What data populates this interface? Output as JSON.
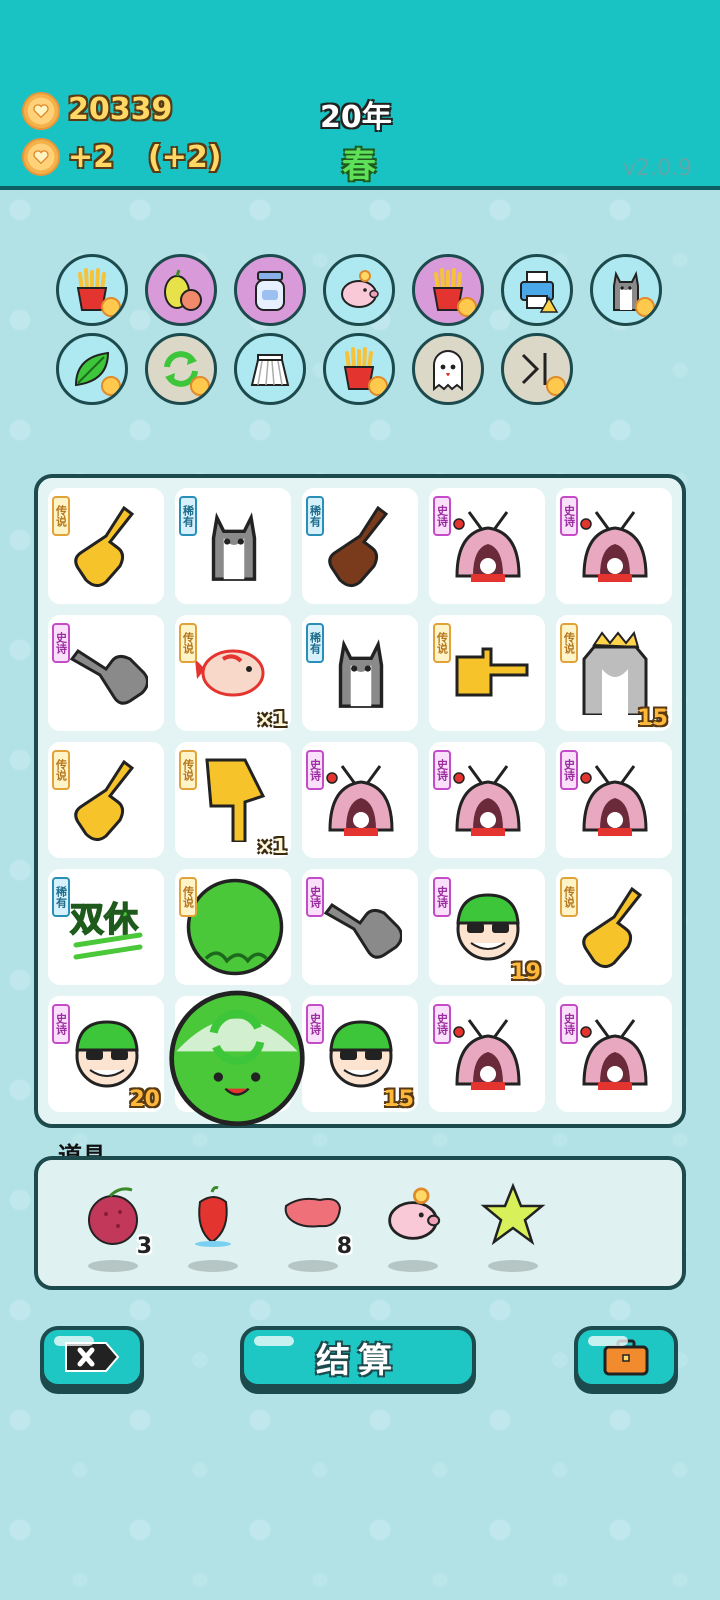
{
  "header": {
    "coins": "20339",
    "income": "+2",
    "income_bonus": "(+2)",
    "year": "20年",
    "season": "春",
    "version": "v2.0.9"
  },
  "relics": [
    {
      "icon": "fries-icon",
      "bg": "#aee8f0",
      "badge": true
    },
    {
      "icon": "pomelo-icon",
      "bg": "#d99ad9",
      "badge": false
    },
    {
      "icon": "jar-icon",
      "bg": "#d99ad9",
      "badge": false
    },
    {
      "icon": "piggy-bank-icon",
      "bg": "#aee8f0",
      "badge": false
    },
    {
      "icon": "fries-icon",
      "bg": "#d99ad9",
      "badge": true
    },
    {
      "icon": "printer-icon",
      "bg": "#aee8f0",
      "badge": false
    },
    {
      "icon": "husky-icon",
      "bg": "#aee8f0",
      "badge": true
    },
    {
      "icon": "leaf-icon",
      "bg": "#aee8f0",
      "badge": true
    },
    {
      "icon": "refresh-icon",
      "bg": "#dcd8c8",
      "badge": true
    },
    {
      "icon": "skirt-icon",
      "bg": "#aee8f0",
      "badge": false
    },
    {
      "icon": "fries-icon",
      "bg": "#aee8f0",
      "badge": true
    },
    {
      "icon": "ghost-icon",
      "bg": "#dcd8c8",
      "badge": false
    },
    {
      "icon": "skip-icon",
      "bg": "#dcd8c8",
      "badge": true
    }
  ],
  "board": {
    "rows": [
      [
        {
          "tag": "传说",
          "kind": "legend",
          "icon": "yellow-finger-icon"
        },
        {
          "tag": "稀有",
          "kind": "rare",
          "icon": "husky-icon"
        },
        {
          "tag": "稀有",
          "kind": "rare",
          "icon": "brown-finger-icon"
        },
        {
          "tag": "史诗",
          "kind": "epic",
          "icon": "rabbit-house-icon"
        },
        {
          "tag": "史诗",
          "kind": "epic",
          "icon": "rabbit-house-icon"
        }
      ],
      [
        {
          "tag": "史诗",
          "kind": "epic",
          "icon": "gray-finger-icon"
        },
        {
          "tag": "传说",
          "kind": "legend",
          "icon": "koi-fish-icon",
          "mult": "×1"
        },
        {
          "tag": "稀有",
          "kind": "rare",
          "icon": "husky-icon"
        },
        {
          "tag": "传说",
          "kind": "legend",
          "icon": "yellow-point-right-icon"
        },
        {
          "tag": "传说",
          "kind": "legend",
          "icon": "crowned-cat-icon",
          "count": "15"
        }
      ],
      [
        {
          "tag": "传说",
          "kind": "legend",
          "icon": "yellow-finger-icon"
        },
        {
          "tag": "传说",
          "kind": "legend",
          "icon": "big-yellow-finger-icon",
          "mult": "×1"
        },
        {
          "tag": "史诗",
          "kind": "epic",
          "icon": "rabbit-house-icon"
        },
        {
          "tag": "史诗",
          "kind": "epic",
          "icon": "rabbit-house-icon"
        },
        {
          "tag": "史诗",
          "kind": "epic",
          "icon": "rabbit-house-icon"
        }
      ],
      [
        {
          "tag": "稀有",
          "kind": "rare",
          "icon": "double-rest-icon",
          "text": "双休"
        },
        {
          "tag": "传说",
          "kind": "legend",
          "icon": "green-ball-icon"
        },
        {
          "tag": "史诗",
          "kind": "epic",
          "icon": "gray-finger-icon"
        },
        {
          "tag": "史诗",
          "kind": "epic",
          "icon": "face-glasses-icon",
          "count": "19"
        },
        {
          "tag": "传说",
          "kind": "legend",
          "icon": "yellow-finger-icon"
        }
      ],
      [
        {
          "tag": "史诗",
          "kind": "epic",
          "icon": "face-glasses-icon",
          "count": "20"
        },
        {
          "tag": "",
          "kind": "none",
          "icon": "green-refresh-ball-icon"
        },
        {
          "tag": "史诗",
          "kind": "epic",
          "icon": "face-glasses-icon",
          "count": "15"
        },
        {
          "tag": "史诗",
          "kind": "epic",
          "icon": "rabbit-house-icon"
        },
        {
          "tag": "史诗",
          "kind": "epic",
          "icon": "rabbit-house-icon"
        }
      ]
    ]
  },
  "props": {
    "label": "道具",
    "items": [
      {
        "icon": "lychee-icon",
        "count": "3"
      },
      {
        "icon": "chili-icon",
        "count": ""
      },
      {
        "icon": "liver-icon",
        "count": "8"
      },
      {
        "icon": "piggy-bank-icon",
        "count": ""
      },
      {
        "icon": "star-icon",
        "count": ""
      }
    ]
  },
  "buttons": {
    "settle": "结算"
  }
}
